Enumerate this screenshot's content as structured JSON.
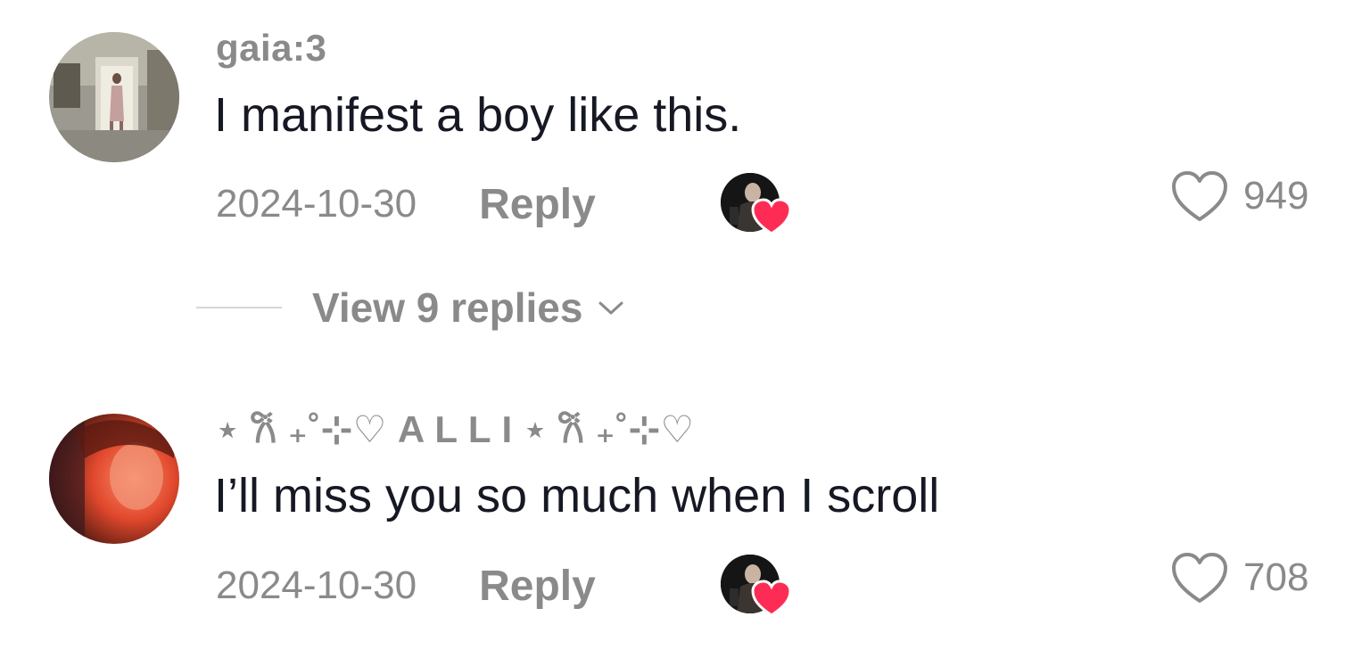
{
  "comments": [
    {
      "username": "gaia:3",
      "text": "I manifest a boy like this.",
      "date": "2024-10-30",
      "reply_label": "Reply",
      "likes": "949",
      "replies_label": "View 9 replies"
    },
    {
      "username": "⋆ 𐙚 ₊˚⊹♡ A L L I ⋆ 𐙚 ₊˚⊹♡",
      "text": "I’ll miss you so much when I scroll",
      "date": "2024-10-30",
      "reply_label": "Reply",
      "likes": "708"
    }
  ],
  "icons": {
    "like": "heart-outline-icon",
    "creator_like": "heart-filled-icon",
    "expand": "chevron-down-icon"
  },
  "colors": {
    "secondary_text": "#8a8a8a",
    "primary_text": "#161823",
    "heart_badge": "#fe2c55"
  }
}
